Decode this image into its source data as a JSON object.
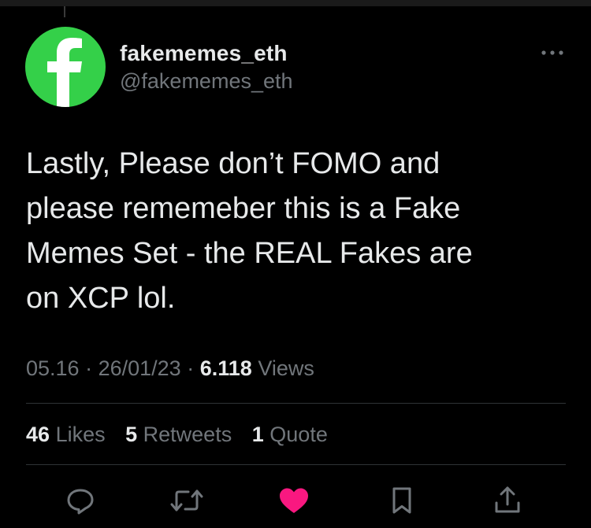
{
  "author": {
    "display_name": "fakememes_eth",
    "handle": "@fakememes_eth",
    "avatar_letter": "f",
    "avatar_color": "#34d049"
  },
  "tweet": {
    "text_lines": [
      "Lastly, Please don’t FOMO and",
      "please rememeber this is a Fake",
      "Memes Set - the REAL Fakes are",
      "on XCP lol."
    ],
    "time": "05.16",
    "date": "26/01/23",
    "views_count": "6.118",
    "views_label": "Views"
  },
  "stats": {
    "likes_count": "46",
    "likes_label": "Likes",
    "retweets_count": "5",
    "retweets_label": "Retweets",
    "quotes_count": "1",
    "quotes_label": "Quote"
  },
  "actions": {
    "icons": [
      "reply-icon",
      "retweet-icon",
      "like-icon",
      "bookmark-icon",
      "share-icon"
    ],
    "like_color": "#f91880",
    "icon_color": "#71767b"
  }
}
